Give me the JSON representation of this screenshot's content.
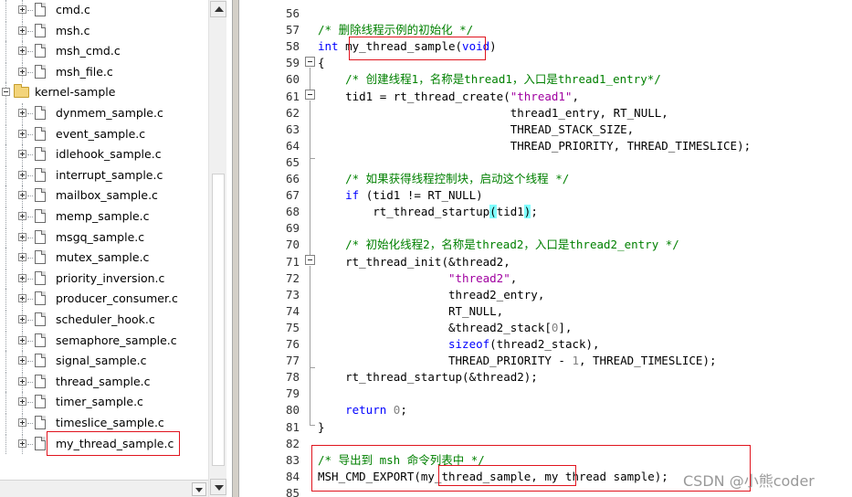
{
  "tree": {
    "items": [
      {
        "label": "cmd.c",
        "type": "file",
        "level": 2
      },
      {
        "label": "msh.c",
        "type": "file",
        "level": 2
      },
      {
        "label": "msh_cmd.c",
        "type": "file",
        "level": 2
      },
      {
        "label": "msh_file.c",
        "type": "file",
        "level": 2
      },
      {
        "label": "kernel-sample",
        "type": "folder",
        "level": 1,
        "expanded": true
      },
      {
        "label": "dynmem_sample.c",
        "type": "file",
        "level": 2
      },
      {
        "label": "event_sample.c",
        "type": "file",
        "level": 2
      },
      {
        "label": "idlehook_sample.c",
        "type": "file",
        "level": 2
      },
      {
        "label": "interrupt_sample.c",
        "type": "file",
        "level": 2
      },
      {
        "label": "mailbox_sample.c",
        "type": "file",
        "level": 2
      },
      {
        "label": "memp_sample.c",
        "type": "file",
        "level": 2
      },
      {
        "label": "msgq_sample.c",
        "type": "file",
        "level": 2
      },
      {
        "label": "mutex_sample.c",
        "type": "file",
        "level": 2
      },
      {
        "label": "priority_inversion.c",
        "type": "file",
        "level": 2
      },
      {
        "label": "producer_consumer.c",
        "type": "file",
        "level": 2
      },
      {
        "label": "scheduler_hook.c",
        "type": "file",
        "level": 2
      },
      {
        "label": "semaphore_sample.c",
        "type": "file",
        "level": 2
      },
      {
        "label": "signal_sample.c",
        "type": "file",
        "level": 2
      },
      {
        "label": "thread_sample.c",
        "type": "file",
        "level": 2
      },
      {
        "label": "timer_sample.c",
        "type": "file",
        "level": 2
      },
      {
        "label": "timeslice_sample.c",
        "type": "file",
        "level": 2
      },
      {
        "label": "my_thread_sample.c",
        "type": "file",
        "level": 2,
        "highlighted": true
      }
    ]
  },
  "editor": {
    "lines": [
      {
        "num": "56",
        "code": ""
      },
      {
        "num": "57",
        "code": "/* 删除线程示例的初始化 */"
      },
      {
        "num": "58",
        "code": "int my_thread_sample(void)"
      },
      {
        "num": "59",
        "code": "{"
      },
      {
        "num": "60",
        "code": "    /* 创建线程1，名称是thread1，入口是thread1_entry*/"
      },
      {
        "num": "61",
        "code": "    tid1 = rt_thread_create(\"thread1\","
      },
      {
        "num": "62",
        "code": "                            thread1_entry, RT_NULL,"
      },
      {
        "num": "63",
        "code": "                            THREAD_STACK_SIZE,"
      },
      {
        "num": "64",
        "code": "                            THREAD_PRIORITY, THREAD_TIMESLICE);"
      },
      {
        "num": "65",
        "code": ""
      },
      {
        "num": "66",
        "code": "    /* 如果获得线程控制块，启动这个线程 */"
      },
      {
        "num": "67",
        "code": "    if (tid1 != RT_NULL)"
      },
      {
        "num": "68",
        "code": "        rt_thread_startup(tid1);"
      },
      {
        "num": "69",
        "code": ""
      },
      {
        "num": "70",
        "code": "    /* 初始化线程2，名称是thread2，入口是thread2_entry */"
      },
      {
        "num": "71",
        "code": "    rt_thread_init(&thread2,"
      },
      {
        "num": "72",
        "code": "                   \"thread2\","
      },
      {
        "num": "73",
        "code": "                   thread2_entry,"
      },
      {
        "num": "74",
        "code": "                   RT_NULL,"
      },
      {
        "num": "75",
        "code": "                   &thread2_stack[0],"
      },
      {
        "num": "76",
        "code": "                   sizeof(thread2_stack),"
      },
      {
        "num": "77",
        "code": "                   THREAD_PRIORITY - 1, THREAD_TIMESLICE);"
      },
      {
        "num": "78",
        "code": "    rt_thread_startup(&thread2);"
      },
      {
        "num": "79",
        "code": ""
      },
      {
        "num": "80",
        "code": "    return 0;"
      },
      {
        "num": "81",
        "code": "}"
      },
      {
        "num": "82",
        "code": ""
      },
      {
        "num": "83",
        "code": "/* 导出到 msh 命令列表中 */"
      },
      {
        "num": "84",
        "code": "MSH_CMD_EXPORT(my_thread_sample, my thread sample);"
      },
      {
        "num": "85",
        "code": ""
      }
    ]
  },
  "watermark": "CSDN @小熊coder",
  "colors": {
    "comment": "#008000",
    "keyword": "#0000ff",
    "string": "#a000a0",
    "number": "#808080",
    "highlight_box": "#e0141e",
    "paren_match": "#80ffff"
  }
}
